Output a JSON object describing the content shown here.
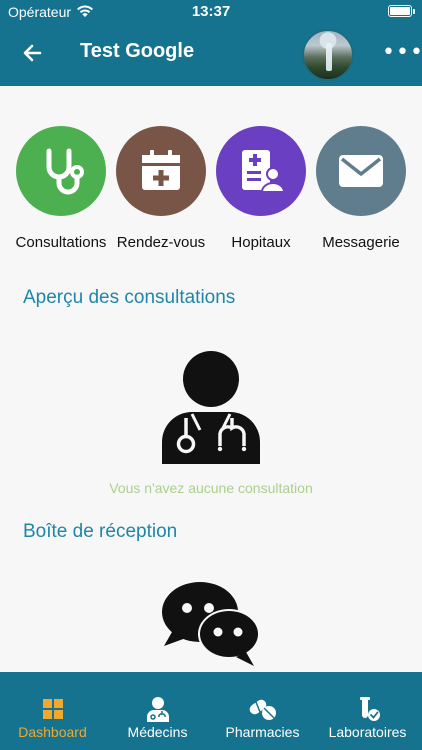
{
  "status_bar": {
    "carrier": "Opérateur",
    "time": "13:37"
  },
  "header": {
    "title": "Test Google",
    "more_label": "•••"
  },
  "quick_actions": [
    {
      "label": "Consultations",
      "icon": "stethoscope-icon",
      "color": "#4caf50"
    },
    {
      "label": "Rendez-vous",
      "icon": "calendar-plus-icon",
      "color": "#795548"
    },
    {
      "label": "Hopitaux",
      "icon": "hospital-badge-icon",
      "color": "#6a3fc1"
    },
    {
      "label": "Messagerie",
      "icon": "envelope-icon",
      "color": "#5f7d8c"
    }
  ],
  "consultations": {
    "title": "Aperçu des consultations",
    "empty_message": "Vous n'avez aucune consultation"
  },
  "inbox": {
    "title": "Boîte de réception"
  },
  "tabbar": {
    "items": [
      {
        "label": "Dashboard",
        "icon": "dashboard-icon",
        "active": true
      },
      {
        "label": "Médecins",
        "icon": "doctor-icon",
        "active": false
      },
      {
        "label": "Pharmacies",
        "icon": "pills-icon",
        "active": false
      },
      {
        "label": "Laboratoires",
        "icon": "test-tube-icon",
        "active": false
      }
    ],
    "active_color": "#f0a92e"
  }
}
